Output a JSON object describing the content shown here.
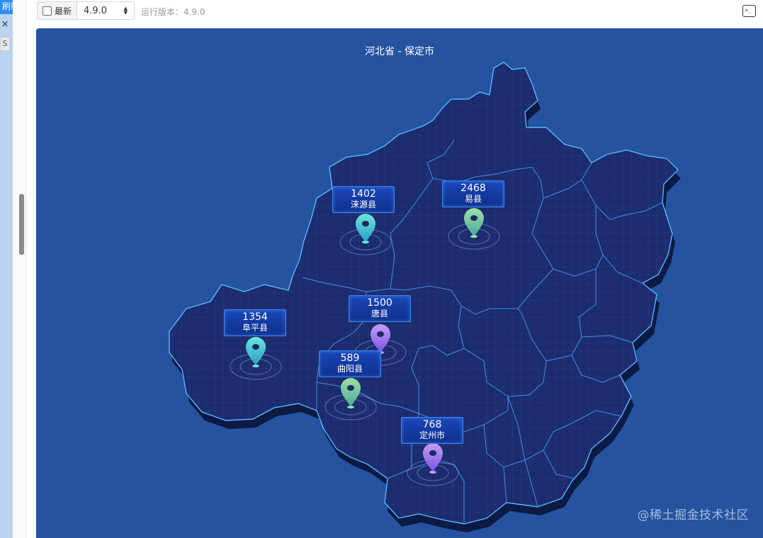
{
  "sidebar": {
    "refresh_label": "刷新",
    "close_label": "×",
    "tab_label": "S"
  },
  "toolbar": {
    "latest_label": "最新",
    "version_value": "4.9.0",
    "run_version_label": "运行版本：4.9.0",
    "terminal_icon": "terminal-icon"
  },
  "chart": {
    "title": "河北省 - 保定市",
    "watermark": "@稀土掘金技术社区",
    "colors": {
      "background": "#2553a0",
      "map_fill": "#1d2c6e",
      "map_stroke": "#4fb5ff",
      "label_bg": "#1a47b8"
    }
  },
  "chart_data": {
    "type": "map",
    "title": "河北省 - 保定市",
    "points": [
      {
        "name": "涞源县",
        "value": 1402,
        "color": "teal"
      },
      {
        "name": "易县",
        "value": 2468,
        "color": "green"
      },
      {
        "name": "唐县",
        "value": 1500,
        "color": "purple"
      },
      {
        "name": "阜平县",
        "value": 1354,
        "color": "teal"
      },
      {
        "name": "曲阳县",
        "value": 589,
        "color": "green"
      },
      {
        "name": "定州市",
        "value": 768,
        "color": "purple"
      }
    ]
  }
}
